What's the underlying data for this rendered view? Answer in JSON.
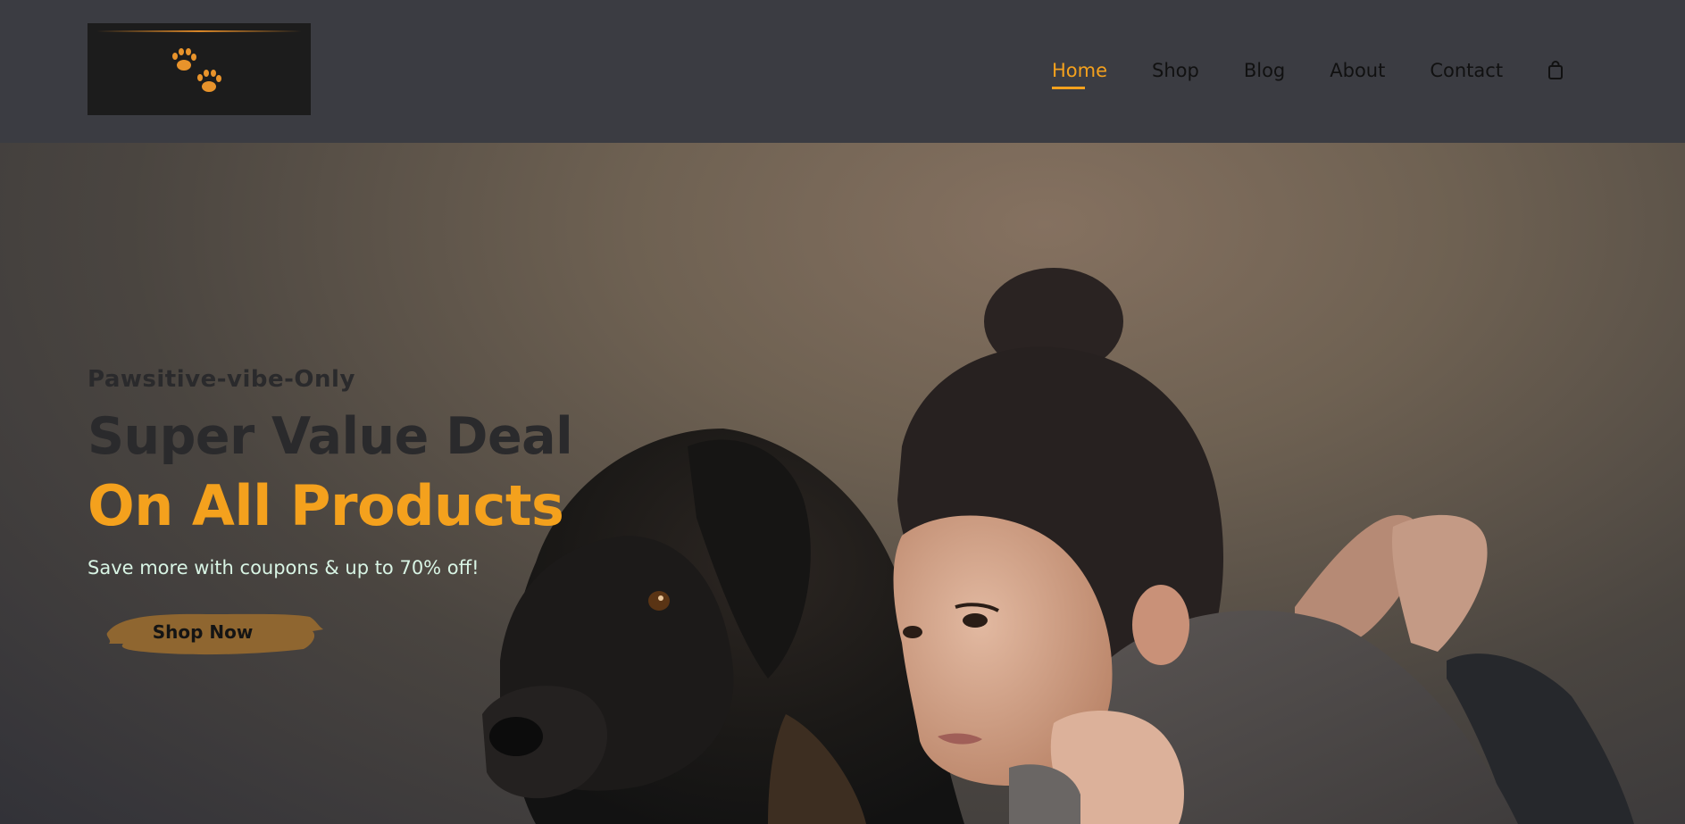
{
  "header": {
    "logo_alt": "paw prints logo",
    "nav": [
      {
        "label": "Home",
        "active": true
      },
      {
        "label": "Shop"
      },
      {
        "label": "Blog"
      },
      {
        "label": "About"
      },
      {
        "label": "Contact"
      }
    ],
    "cart_icon": "shopping-bag-icon"
  },
  "hero": {
    "eyebrow": "Pawsitive-vibe-Only",
    "headline": "Super Value Deal",
    "headline_accent": "On All Products",
    "subtext": "Save more with coupons & up to 70% off!",
    "cta_label": "Shop Now"
  },
  "colors": {
    "accent": "#f4a11d",
    "header_bg": "#3b3c42",
    "button_brush": "#8f6630",
    "subtext": "#d8f4e4"
  }
}
